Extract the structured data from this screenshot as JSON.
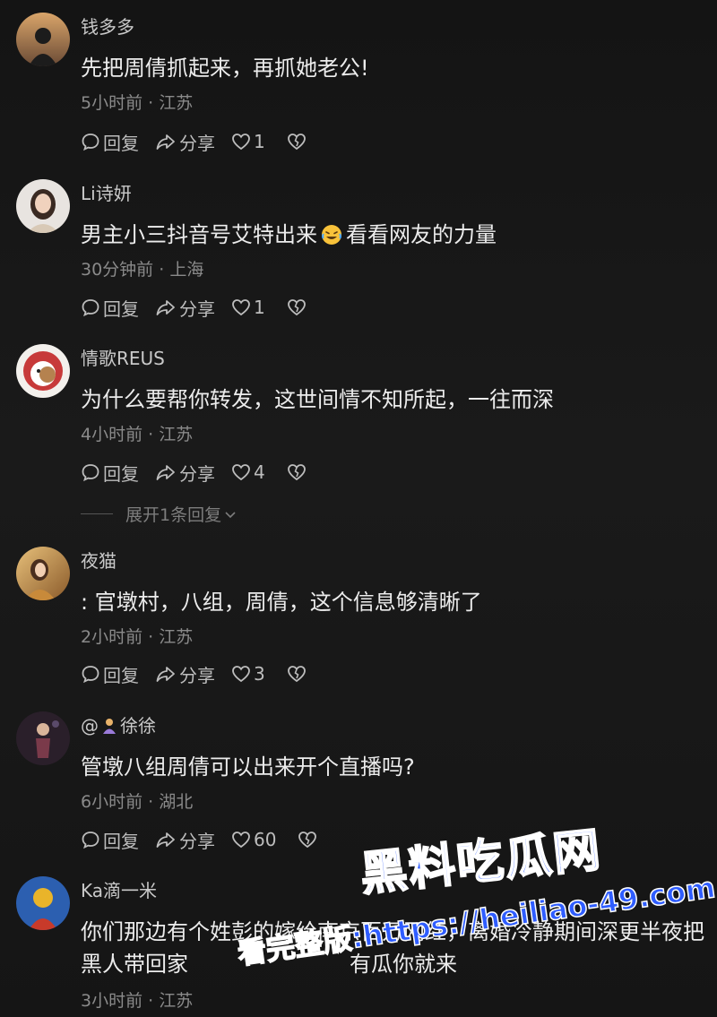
{
  "comments": [
    {
      "username": "钱多多",
      "text": "先把周倩抓起来，再抓她老公!",
      "time": "5小时前",
      "location": "江苏",
      "reply_label": "回复",
      "share_label": "分享",
      "likes": "1"
    },
    {
      "username": "Li诗妍",
      "text_before": "男主小三抖音号艾特出来",
      "text_after": "看看网友的力量",
      "emoji": "laughing-crying-emoji",
      "time": "30分钟前",
      "location": "上海",
      "reply_label": "回复",
      "share_label": "分享",
      "likes": "1"
    },
    {
      "username": "情歌REUS",
      "text": "为什么要帮你转发，这世间情不知所起，一往而深",
      "time": "4小时前",
      "location": "江苏",
      "reply_label": "回复",
      "share_label": "分享",
      "likes": "4",
      "expand_replies": "展开1条回复"
    },
    {
      "username": "夜猫",
      "text": ": 官墩村，八组，周倩，这个信息够清晰了",
      "time": "2小时前",
      "location": "江苏",
      "reply_label": "回复",
      "share_label": "分享",
      "likes": "3"
    },
    {
      "username_prefix": "@",
      "username": "徐徐",
      "username_emoji": "person-emoji",
      "text": "管墩八组周倩可以出来开个直播吗?",
      "time": "6小时前",
      "location": "湖北",
      "reply_label": "回复",
      "share_label": "分享",
      "likes": "60"
    },
    {
      "username": "Ka滴一米",
      "text": "你们那边有个姓彭的嫁给南京百万网红，离婚冷静期间深更半夜把黑人带回家",
      "text_tail": "有瓜你就来",
      "time": "3小时前",
      "location": "江苏"
    }
  ],
  "meta_separator": "·",
  "watermark": {
    "title": "黑料吃瓜网",
    "url_prefix": "看完整版:",
    "url": "https://heiliao-49.com"
  },
  "colors": {
    "background": "#151515",
    "username": "#c9c9c9",
    "text": "#ececec",
    "meta": "#8a8a8a",
    "watermark": "#2f5dff"
  }
}
